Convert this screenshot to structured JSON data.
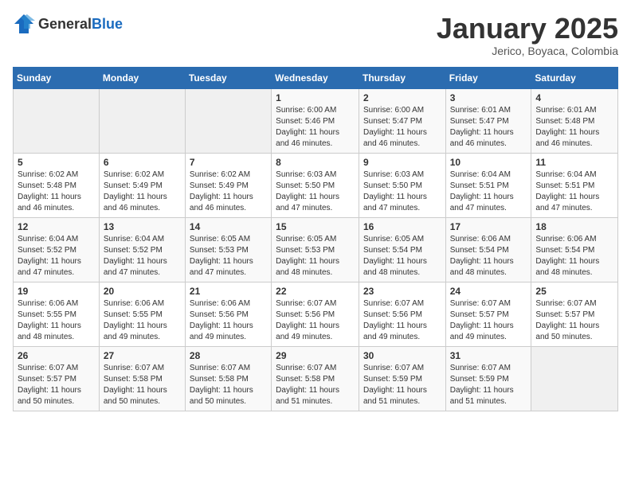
{
  "header": {
    "logo_general": "General",
    "logo_blue": "Blue",
    "month": "January 2025",
    "location": "Jerico, Boyaca, Colombia"
  },
  "days_of_week": [
    "Sunday",
    "Monday",
    "Tuesday",
    "Wednesday",
    "Thursday",
    "Friday",
    "Saturday"
  ],
  "weeks": [
    [
      {
        "day": "",
        "content": ""
      },
      {
        "day": "",
        "content": ""
      },
      {
        "day": "",
        "content": ""
      },
      {
        "day": "1",
        "content": "Sunrise: 6:00 AM\nSunset: 5:46 PM\nDaylight: 11 hours and 46 minutes."
      },
      {
        "day": "2",
        "content": "Sunrise: 6:00 AM\nSunset: 5:47 PM\nDaylight: 11 hours and 46 minutes."
      },
      {
        "day": "3",
        "content": "Sunrise: 6:01 AM\nSunset: 5:47 PM\nDaylight: 11 hours and 46 minutes."
      },
      {
        "day": "4",
        "content": "Sunrise: 6:01 AM\nSunset: 5:48 PM\nDaylight: 11 hours and 46 minutes."
      }
    ],
    [
      {
        "day": "5",
        "content": "Sunrise: 6:02 AM\nSunset: 5:48 PM\nDaylight: 11 hours and 46 minutes."
      },
      {
        "day": "6",
        "content": "Sunrise: 6:02 AM\nSunset: 5:49 PM\nDaylight: 11 hours and 46 minutes."
      },
      {
        "day": "7",
        "content": "Sunrise: 6:02 AM\nSunset: 5:49 PM\nDaylight: 11 hours and 46 minutes."
      },
      {
        "day": "8",
        "content": "Sunrise: 6:03 AM\nSunset: 5:50 PM\nDaylight: 11 hours and 47 minutes."
      },
      {
        "day": "9",
        "content": "Sunrise: 6:03 AM\nSunset: 5:50 PM\nDaylight: 11 hours and 47 minutes."
      },
      {
        "day": "10",
        "content": "Sunrise: 6:04 AM\nSunset: 5:51 PM\nDaylight: 11 hours and 47 minutes."
      },
      {
        "day": "11",
        "content": "Sunrise: 6:04 AM\nSunset: 5:51 PM\nDaylight: 11 hours and 47 minutes."
      }
    ],
    [
      {
        "day": "12",
        "content": "Sunrise: 6:04 AM\nSunset: 5:52 PM\nDaylight: 11 hours and 47 minutes."
      },
      {
        "day": "13",
        "content": "Sunrise: 6:04 AM\nSunset: 5:52 PM\nDaylight: 11 hours and 47 minutes."
      },
      {
        "day": "14",
        "content": "Sunrise: 6:05 AM\nSunset: 5:53 PM\nDaylight: 11 hours and 47 minutes."
      },
      {
        "day": "15",
        "content": "Sunrise: 6:05 AM\nSunset: 5:53 PM\nDaylight: 11 hours and 48 minutes."
      },
      {
        "day": "16",
        "content": "Sunrise: 6:05 AM\nSunset: 5:54 PM\nDaylight: 11 hours and 48 minutes."
      },
      {
        "day": "17",
        "content": "Sunrise: 6:06 AM\nSunset: 5:54 PM\nDaylight: 11 hours and 48 minutes."
      },
      {
        "day": "18",
        "content": "Sunrise: 6:06 AM\nSunset: 5:54 PM\nDaylight: 11 hours and 48 minutes."
      }
    ],
    [
      {
        "day": "19",
        "content": "Sunrise: 6:06 AM\nSunset: 5:55 PM\nDaylight: 11 hours and 48 minutes."
      },
      {
        "day": "20",
        "content": "Sunrise: 6:06 AM\nSunset: 5:55 PM\nDaylight: 11 hours and 49 minutes."
      },
      {
        "day": "21",
        "content": "Sunrise: 6:06 AM\nSunset: 5:56 PM\nDaylight: 11 hours and 49 minutes."
      },
      {
        "day": "22",
        "content": "Sunrise: 6:07 AM\nSunset: 5:56 PM\nDaylight: 11 hours and 49 minutes."
      },
      {
        "day": "23",
        "content": "Sunrise: 6:07 AM\nSunset: 5:56 PM\nDaylight: 11 hours and 49 minutes."
      },
      {
        "day": "24",
        "content": "Sunrise: 6:07 AM\nSunset: 5:57 PM\nDaylight: 11 hours and 49 minutes."
      },
      {
        "day": "25",
        "content": "Sunrise: 6:07 AM\nSunset: 5:57 PM\nDaylight: 11 hours and 50 minutes."
      }
    ],
    [
      {
        "day": "26",
        "content": "Sunrise: 6:07 AM\nSunset: 5:57 PM\nDaylight: 11 hours and 50 minutes."
      },
      {
        "day": "27",
        "content": "Sunrise: 6:07 AM\nSunset: 5:58 PM\nDaylight: 11 hours and 50 minutes."
      },
      {
        "day": "28",
        "content": "Sunrise: 6:07 AM\nSunset: 5:58 PM\nDaylight: 11 hours and 50 minutes."
      },
      {
        "day": "29",
        "content": "Sunrise: 6:07 AM\nSunset: 5:58 PM\nDaylight: 11 hours and 51 minutes."
      },
      {
        "day": "30",
        "content": "Sunrise: 6:07 AM\nSunset: 5:59 PM\nDaylight: 11 hours and 51 minutes."
      },
      {
        "day": "31",
        "content": "Sunrise: 6:07 AM\nSunset: 5:59 PM\nDaylight: 11 hours and 51 minutes."
      },
      {
        "day": "",
        "content": ""
      }
    ]
  ]
}
